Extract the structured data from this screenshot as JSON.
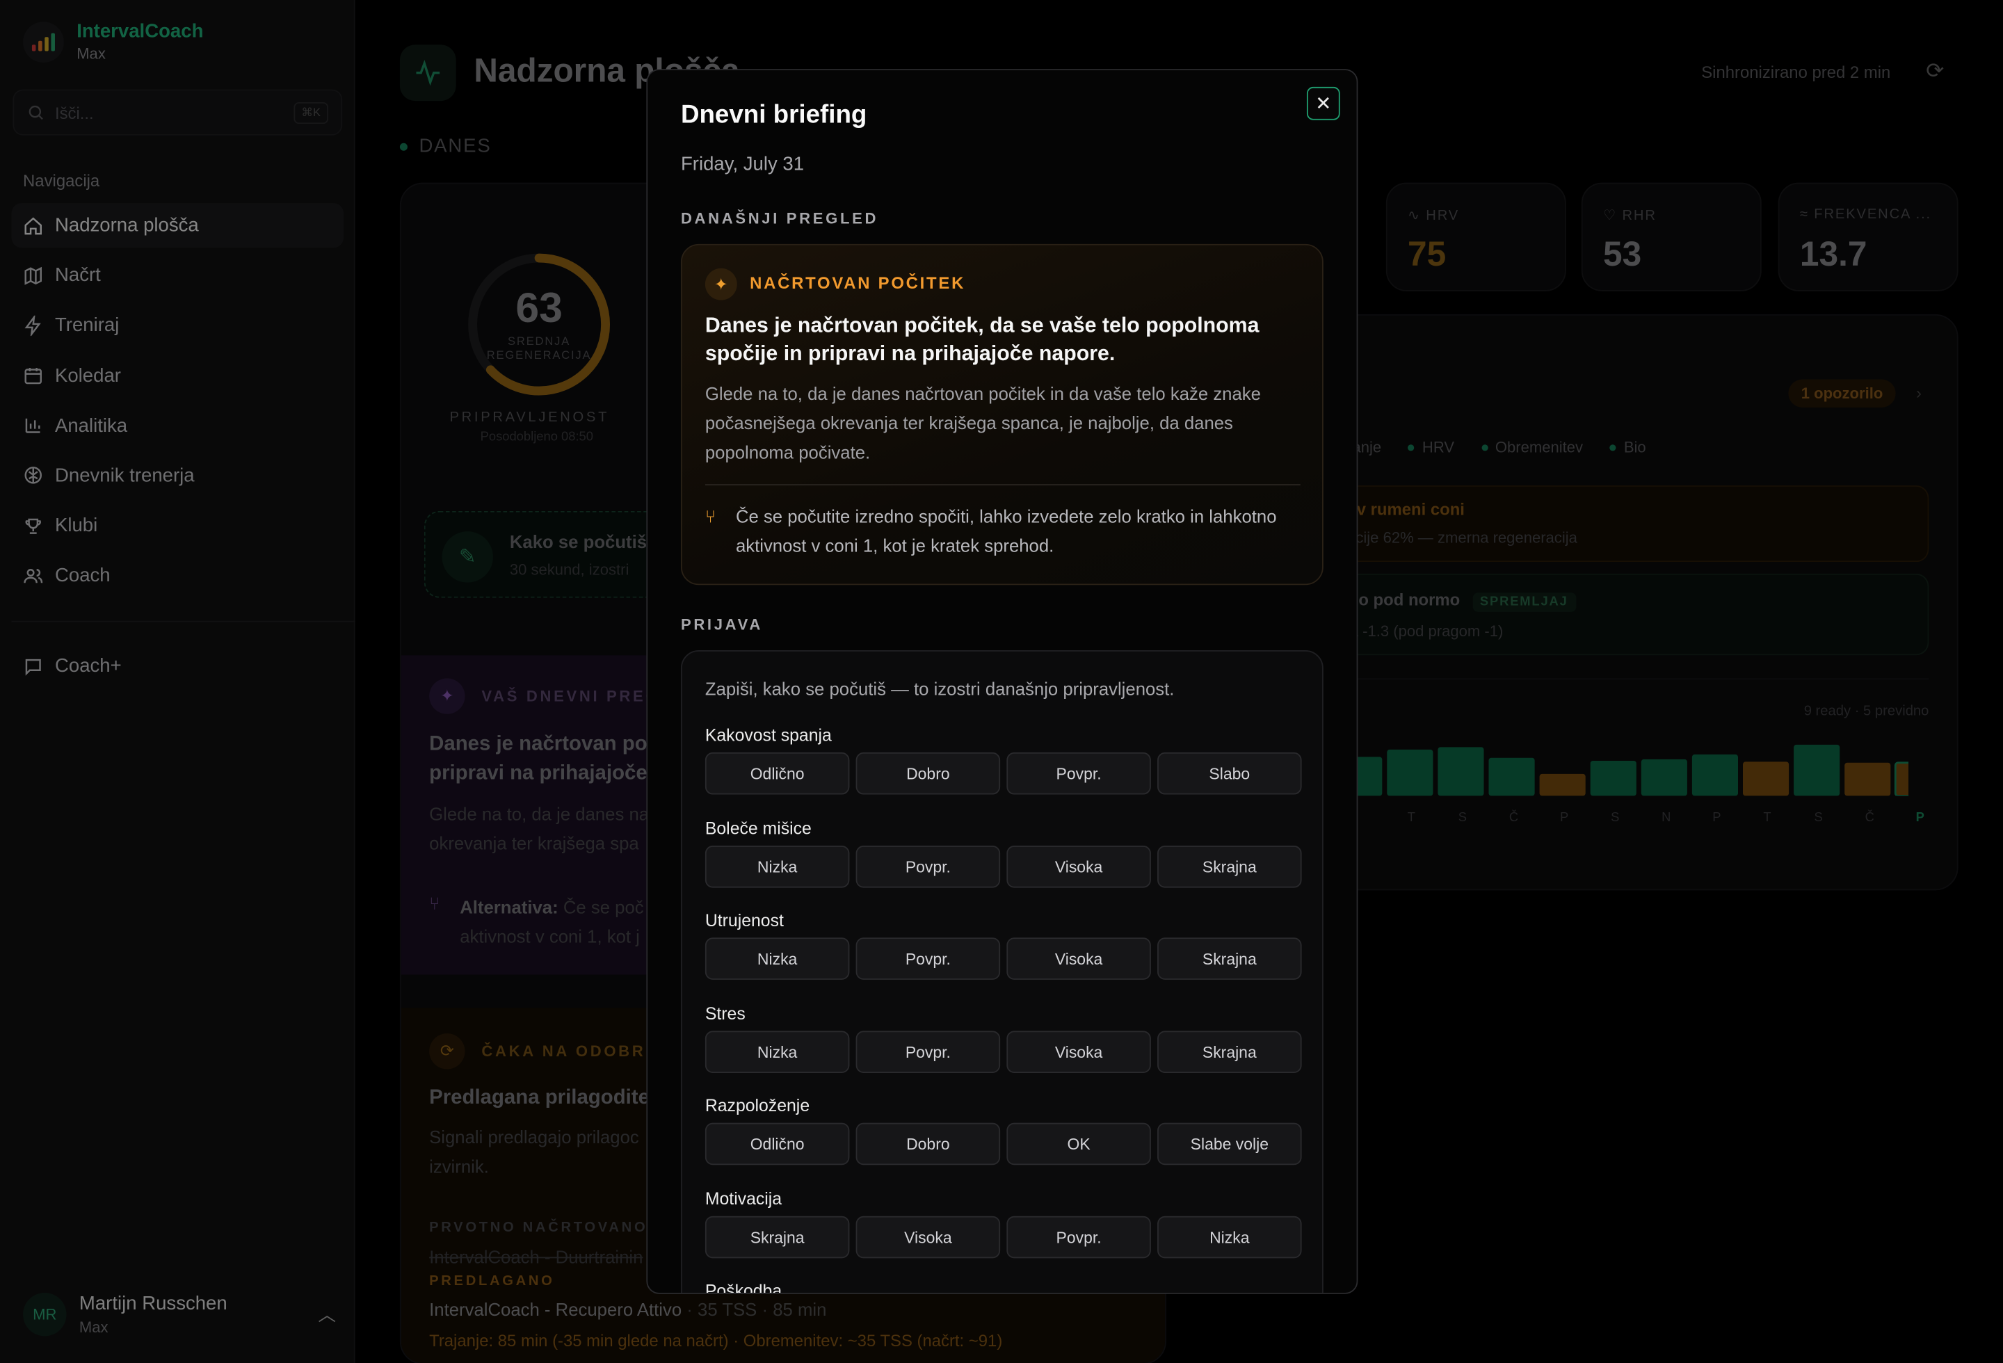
{
  "app": {
    "name": "IntervalCoach",
    "plan": "Max"
  },
  "search": {
    "placeholder": "Išči...",
    "shortcut": "⌘K"
  },
  "nav": {
    "title": "Navigacija",
    "items": [
      {
        "label": "Nadzorna plošča",
        "icon": "home-icon"
      },
      {
        "label": "Načrt",
        "icon": "map-icon"
      },
      {
        "label": "Treniraj",
        "icon": "bolt-icon"
      },
      {
        "label": "Koledar",
        "icon": "calendar-icon"
      },
      {
        "label": "Analitika",
        "icon": "chart-icon"
      },
      {
        "label": "Dnevnik trenerja",
        "icon": "brain-icon"
      },
      {
        "label": "Klubi",
        "icon": "trophy-icon"
      },
      {
        "label": "Coach",
        "icon": "users-icon"
      }
    ],
    "coach_plus": "Coach+"
  },
  "user": {
    "initials": "MR",
    "name": "Martijn Russchen",
    "plan": "Max"
  },
  "header": {
    "title": "Nadzorna plošča",
    "sync": "Sinhronizirano pred 2 min"
  },
  "today": "DANES",
  "readiness": {
    "value": 63,
    "label": "SREDNJA REGENERACIJA",
    "title": "PRIPRAVLJENOST",
    "updated": "Posodobljeno 08:50"
  },
  "checkin_card": {
    "title": "Kako se počutiš",
    "sub": "30 sekund, izostri"
  },
  "bg_brief": {
    "caption": "VAŠ DNEVNI PREG",
    "heading": "Danes je načrtovan po",
    "heading2": "pripravi na prihajajoče",
    "p1": "Glede na to, da je danes na",
    "p2": "okrevanja ter krajšega spa",
    "alt_label": "Alternativa:",
    "alt_text": "Če se poč",
    "alt2": "aktivnost v coni 1, kot j"
  },
  "bg_pending": {
    "caption": "ČAKA NA ODOBRI",
    "heading": "Predlagana prilagoditev",
    "p1": "Signali predlagajo prilagoc",
    "p2": "izvirnik.",
    "orig_cap": "PRVOTNO NAČRTOVANO",
    "orig": "IntervalCoach - Duurtrainin",
    "prop_cap": "PREDLAGANO",
    "prop": "IntervalCoach - Recupero Attivo",
    "prop_tss": "35 TSS",
    "prop_min": "85 min",
    "prop_note": "Trajanje: 85 min (-35 min glede na načrt) · Obremenitev: ~35 TSS (načrt: ~91)"
  },
  "stats": [
    {
      "label": "HRV",
      "value": "75",
      "color": "#c88a1f"
    },
    {
      "label": "RHR",
      "value": "53",
      "color": "#8a8a8e"
    },
    {
      "label": "FREKVENCA ...",
      "value": "13.7",
      "color": "#8a8a8e"
    }
  ],
  "signals": {
    "alerts": "1 opozorilo",
    "legend": [
      "Spanje",
      "HRV",
      "Obremenitev",
      "Bio"
    ],
    "warn1_title": "ija v rumeni coni",
    "warn1_sub": "eracije 62% — zmerna regeneracija",
    "warn2_title": "atno pod normo",
    "warn2_badge": "SPREMLJAJ",
    "warn2_sub": "nca -1.3 (pod pragom -1)",
    "summary": "9 ready · 5 previdno",
    "days": [
      "T",
      "S",
      "Č",
      "P",
      "S",
      "N",
      "P",
      "T",
      "S",
      "Č",
      "P"
    ]
  },
  "bar_chart": {
    "values": [
      0.8,
      0.95,
      1.0,
      0.78,
      0.45,
      0.72,
      0.75,
      0.85,
      0.7,
      1.05,
      0.68,
      0.68
    ],
    "status": [
      "ready",
      "ready",
      "ready",
      "ready",
      "caution",
      "ready",
      "ready",
      "ready",
      "caution",
      "ready",
      "caution",
      "caution"
    ]
  },
  "modal": {
    "title": "Dnevni briefing",
    "date": "Friday, July 31",
    "overview_cap": "DANAŠNJI PREGLED",
    "rest_cap": "NAČRTOVAN POČITEK",
    "rest_heading": "Danes je načrtovan počitek, da se vaše telo popolnoma spočije in pripravi na prihajajoče napore.",
    "rest_body": "Glede na to, da je danes načrtovan počitek in da vaše telo kaže znake počasnejšega okrevanja ter krajšega spanca, je najbolje, da danes popolnoma počivate.",
    "rest_alt": "Če se počutite izredno spočiti, lahko izvedete zelo kratko in lahkotno aktivnost v coni 1, kot je kratek sprehod.",
    "checkin_cap": "PRIJAVA",
    "checkin_intro": "Zapiši, kako se počutiš — to izostri današnjo pripravljenost.",
    "questions": [
      {
        "label": "Kakovost spanja",
        "options": [
          "Odlično",
          "Dobro",
          "Povpr.",
          "Slabo"
        ]
      },
      {
        "label": "Boleče mišice",
        "options": [
          "Nizka",
          "Povpr.",
          "Visoka",
          "Skrajna"
        ]
      },
      {
        "label": "Utrujenost",
        "options": [
          "Nizka",
          "Povpr.",
          "Visoka",
          "Skrajna"
        ]
      },
      {
        "label": "Stres",
        "options": [
          "Nizka",
          "Povpr.",
          "Visoka",
          "Skrajna"
        ]
      },
      {
        "label": "Razpoloženje",
        "options": [
          "Odlično",
          "Dobro",
          "OK",
          "Slabe volje"
        ]
      },
      {
        "label": "Motivacija",
        "options": [
          "Skrajna",
          "Visoka",
          "Povpr.",
          "Nizka"
        ]
      },
      {
        "label": "Poškodba",
        "options": []
      }
    ]
  }
}
